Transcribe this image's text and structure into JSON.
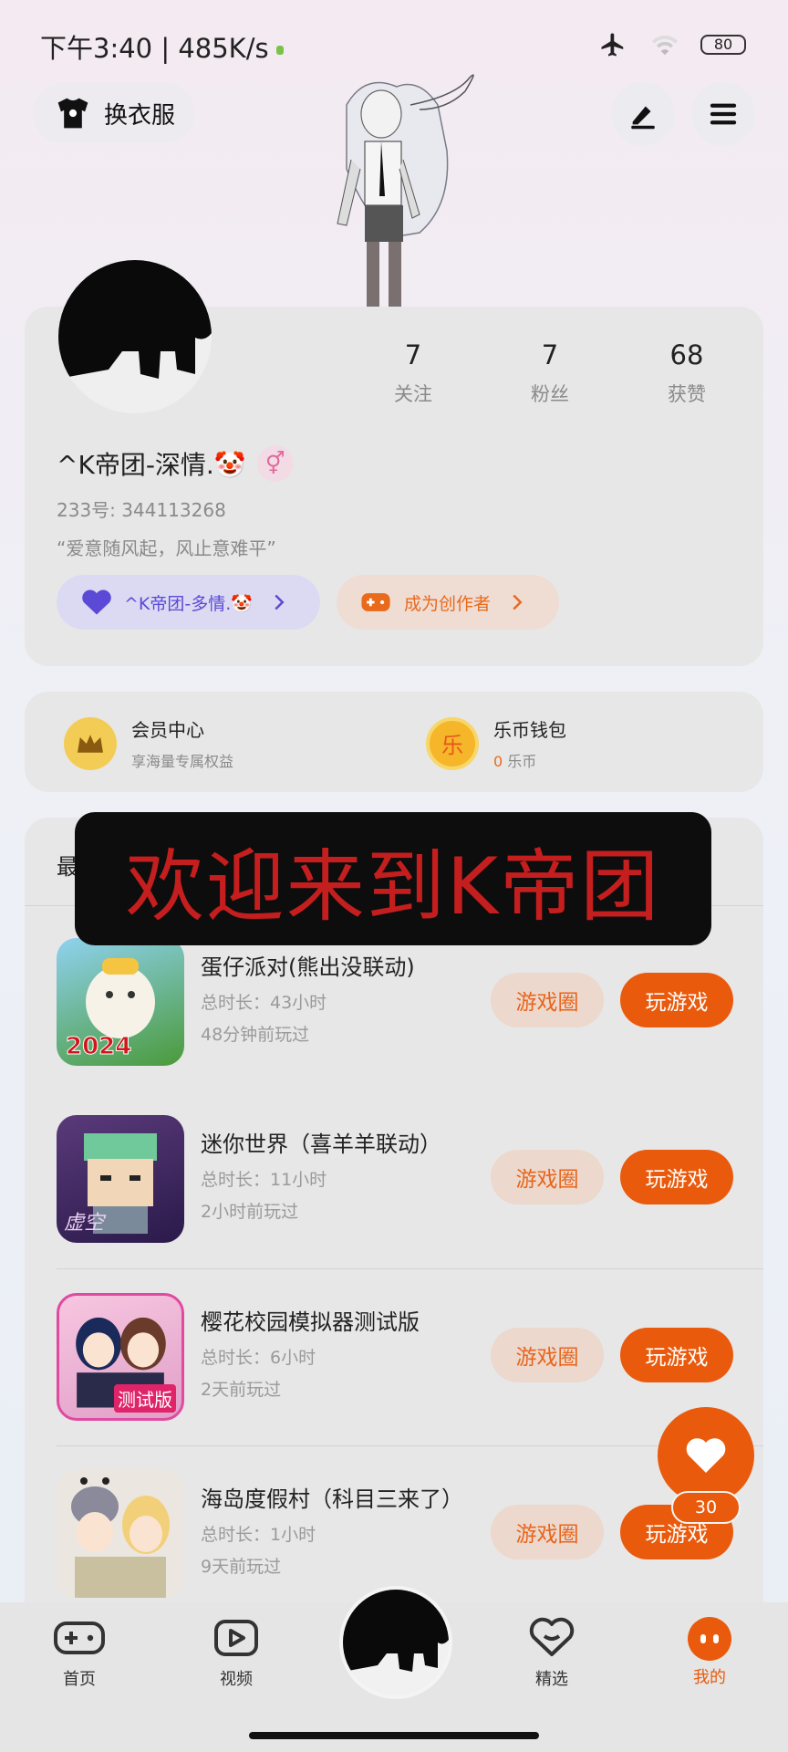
{
  "status_bar": {
    "time": "下午3:40 | 485K/s",
    "battery": "80"
  },
  "header": {
    "outfit_label": "换衣服"
  },
  "profile": {
    "stats": [
      {
        "value": "7",
        "label": "关注"
      },
      {
        "value": "7",
        "label": "粉丝"
      },
      {
        "value": "68",
        "label": "获赞"
      }
    ],
    "nickname": "^K帝团-深情.🤡",
    "gender_symbol": "⚥",
    "uid": "233号: 344113268",
    "bio": "“爱意随风起，风止意难平”",
    "group_pill": "^K帝团-多情.🤡",
    "creator_pill": "成为创作者"
  },
  "vip": {
    "member_title": "会员中心",
    "member_sub": "享海量专属权益",
    "wallet_title": "乐币钱包",
    "wallet_amount": "0",
    "wallet_unit": "乐币",
    "wallet_icon_char": "乐"
  },
  "recent": {
    "label": "最"
  },
  "overlay_banner": "欢迎来到K帝团",
  "games": [
    {
      "name": "蛋仔派对(熊出没联动)",
      "duration": "总时长：43小时",
      "last_played": "48分钟前玩过",
      "circle_label": "游戏圈",
      "play_label": "玩游戏",
      "icon_text": "2024"
    },
    {
      "name": "迷你世界（喜羊羊联动）",
      "duration": "总时长：11小时",
      "last_played": "2小时前玩过",
      "circle_label": "游戏圈",
      "play_label": "玩游戏",
      "icon_text": "虚空"
    },
    {
      "name": "樱花校园模拟器测试版",
      "duration": "总时长：6小时",
      "last_played": "2天前玩过",
      "circle_label": "游戏圈",
      "play_label": "玩游戏",
      "icon_text": "测试版"
    },
    {
      "name": "海岛度假村（科目三来了）",
      "duration": "总时长：1小时",
      "last_played": "9天前玩过",
      "circle_label": "游戏圈",
      "play_label": "玩游戏",
      "icon_text": ""
    }
  ],
  "like_count": "30",
  "bottom_nav": [
    {
      "label": "首页"
    },
    {
      "label": "视频"
    },
    {
      "label": "精选"
    },
    {
      "label": "我的"
    }
  ],
  "colors": {
    "accent_orange": "#ea5a0c",
    "purple": "#5a4ad6",
    "banner_red": "#c41e1e"
  }
}
